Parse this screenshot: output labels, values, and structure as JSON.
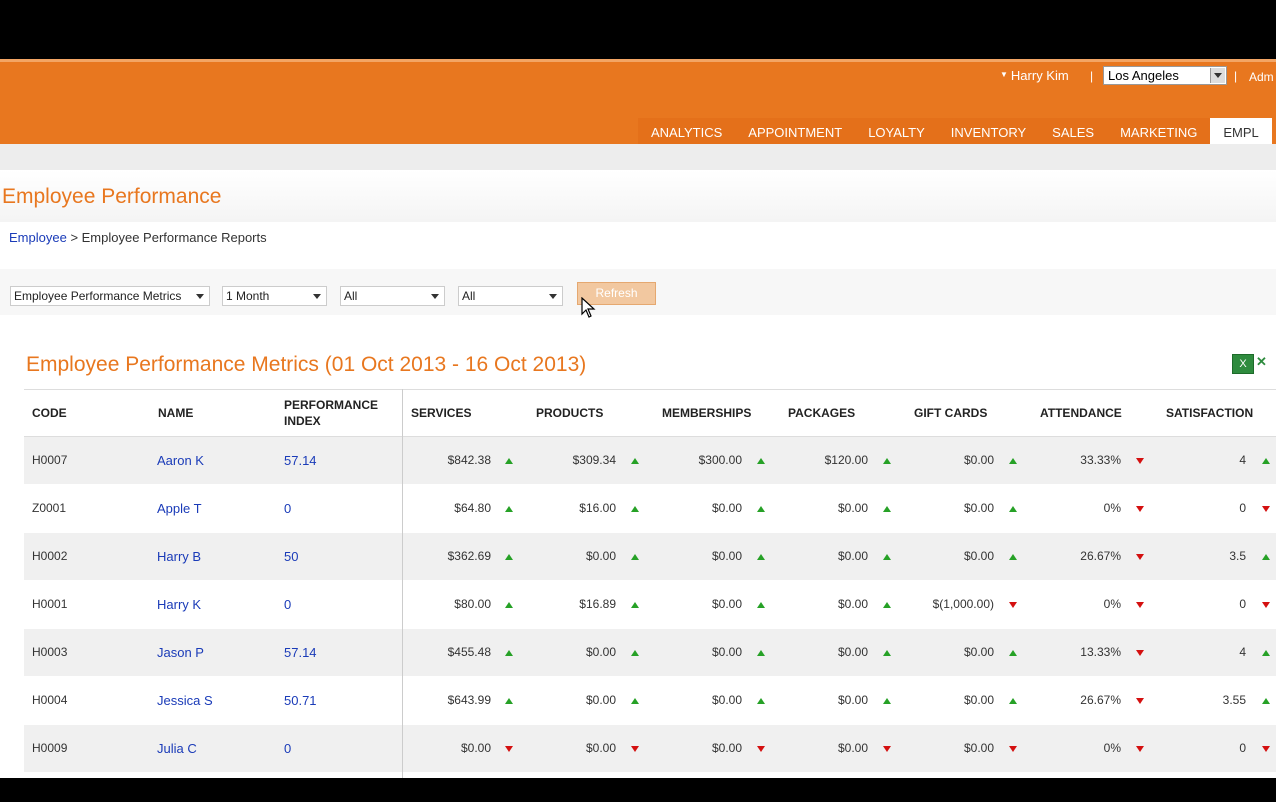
{
  "header": {
    "user_name": "Harry Kim",
    "location": "Los Angeles",
    "admin_link": "Adm",
    "nav": [
      "ANALYTICS",
      "APPOINTMENT",
      "LOYALTY",
      "INVENTORY",
      "SALES",
      "MARKETING",
      "EMPL"
    ],
    "active_nav": "EMPL"
  },
  "page": {
    "title": "Employee Performance",
    "breadcrumb_link": "Employee",
    "breadcrumb_current": "> Employee Performance Reports"
  },
  "filters": {
    "report": "Employee Performance Metrics",
    "period": "1 Month",
    "filter1": "All",
    "filter2": "All",
    "refresh_label": "Refresh"
  },
  "report": {
    "title": "Employee Performance Metrics (01 Oct 2013 - 16 Oct 2013)",
    "columns": [
      "CODE",
      "NAME",
      "PERFORMANCE INDEX",
      "SERVICES",
      "PRODUCTS",
      "MEMBERSHIPS",
      "PACKAGES",
      "GIFT CARDS",
      "ATTENDANCE",
      "SATISFACTION"
    ],
    "rows": [
      {
        "code": "H0007",
        "name": "Aaron K",
        "index": "57.14",
        "services": "$842.38",
        "products": "$309.34",
        "memberships": "$300.00",
        "packages": "$120.00",
        "gift_cards": "$0.00",
        "attendance": "33.33%",
        "satisfaction": "4",
        "trends": [
          "up",
          "up",
          "up",
          "up",
          "up",
          "down",
          "up"
        ]
      },
      {
        "code": "Z0001",
        "name": "Apple T",
        "index": "0",
        "services": "$64.80",
        "products": "$16.00",
        "memberships": "$0.00",
        "packages": "$0.00",
        "gift_cards": "$0.00",
        "attendance": "0%",
        "satisfaction": "0",
        "trends": [
          "up",
          "up",
          "up",
          "up",
          "up",
          "down",
          "down"
        ]
      },
      {
        "code": "H0002",
        "name": "Harry B",
        "index": "50",
        "services": "$362.69",
        "products": "$0.00",
        "memberships": "$0.00",
        "packages": "$0.00",
        "gift_cards": "$0.00",
        "attendance": "26.67%",
        "satisfaction": "3.5",
        "trends": [
          "up",
          "up",
          "up",
          "up",
          "up",
          "down",
          "up"
        ]
      },
      {
        "code": "H0001",
        "name": "Harry K",
        "index": "0",
        "services": "$80.00",
        "products": "$16.89",
        "memberships": "$0.00",
        "packages": "$0.00",
        "gift_cards": "$(1,000.00)",
        "attendance": "0%",
        "satisfaction": "0",
        "trends": [
          "up",
          "up",
          "up",
          "up",
          "down",
          "down",
          "down"
        ]
      },
      {
        "code": "H0003",
        "name": "Jason P",
        "index": "57.14",
        "services": "$455.48",
        "products": "$0.00",
        "memberships": "$0.00",
        "packages": "$0.00",
        "gift_cards": "$0.00",
        "attendance": "13.33%",
        "satisfaction": "4",
        "trends": [
          "up",
          "up",
          "up",
          "up",
          "up",
          "down",
          "up"
        ]
      },
      {
        "code": "H0004",
        "name": "Jessica S",
        "index": "50.71",
        "services": "$643.99",
        "products": "$0.00",
        "memberships": "$0.00",
        "packages": "$0.00",
        "gift_cards": "$0.00",
        "attendance": "26.67%",
        "satisfaction": "3.55",
        "trends": [
          "up",
          "up",
          "up",
          "up",
          "up",
          "down",
          "up"
        ]
      },
      {
        "code": "H0009",
        "name": "Julia C",
        "index": "0",
        "services": "$0.00",
        "products": "$0.00",
        "memberships": "$0.00",
        "packages": "$0.00",
        "gift_cards": "$0.00",
        "attendance": "0%",
        "satisfaction": "0",
        "trends": [
          "down",
          "down",
          "down",
          "down",
          "down",
          "down",
          "down"
        ]
      }
    ]
  },
  "colors": {
    "brand": "#e8771f",
    "link": "#1a3bb8",
    "up": "#26a126",
    "down": "#d41010"
  }
}
